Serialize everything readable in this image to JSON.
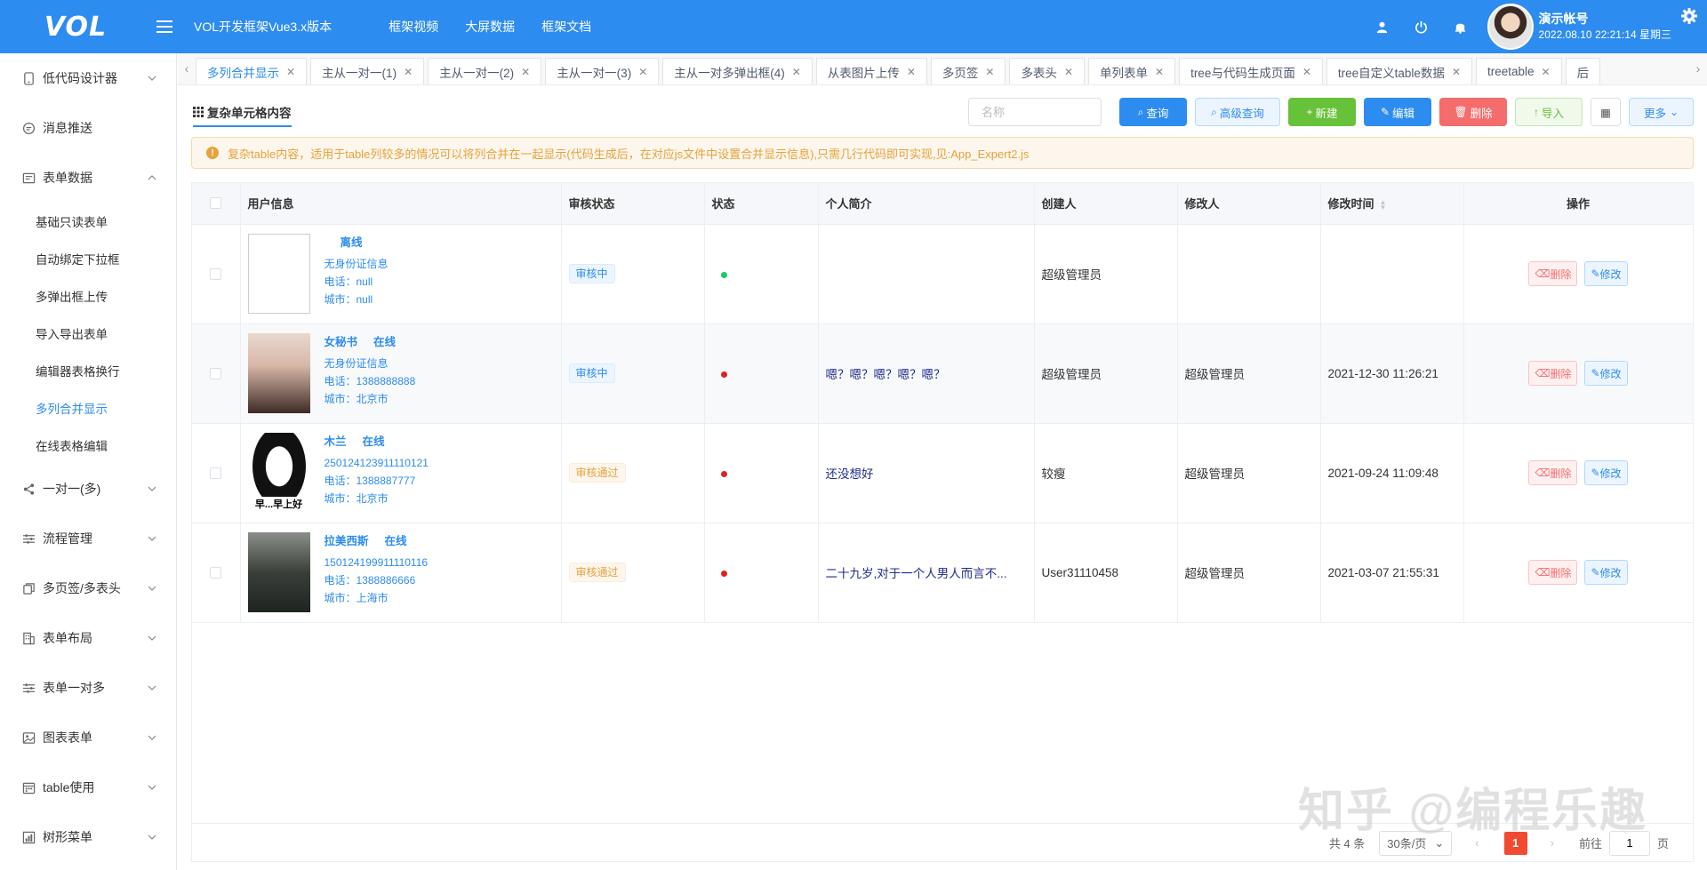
{
  "header": {
    "logo": "VOL",
    "app_title": "VOL开发框架Vue3.x版本",
    "nav": [
      "框架视频",
      "大屏数据",
      "框架文档"
    ],
    "user_name": "演示帐号",
    "user_date": "2022.08.10 22:21:14 星期三"
  },
  "sidebar": {
    "items": [
      {
        "label": "低代码设计器",
        "icon": "phone-icon"
      },
      {
        "label": "消息推送",
        "icon": "message-icon"
      },
      {
        "label": "表单数据",
        "icon": "form-icon"
      }
    ],
    "sub_items": [
      "基础只读表单",
      "自动绑定下拉框",
      "多弹出框上传",
      "导入导出表单",
      "编辑器表格换行",
      "多列合并显示",
      "在线表格编辑"
    ],
    "items_after": [
      {
        "label": "一对一(多)",
        "icon": "share-icon"
      },
      {
        "label": "流程管理",
        "icon": "sliders-icon"
      },
      {
        "label": "多页签/多表头",
        "icon": "copy-icon"
      },
      {
        "label": "表单布局",
        "icon": "building-icon"
      },
      {
        "label": "表单一对多",
        "icon": "sliders-icon"
      },
      {
        "label": "图表表单",
        "icon": "image-icon"
      },
      {
        "label": "table使用",
        "icon": "calendar-icon"
      },
      {
        "label": "树形菜单",
        "icon": "chart-icon"
      }
    ]
  },
  "tabs": [
    "多列合并显示",
    "主从一对一(1)",
    "主从一对一(2)",
    "主从一对一(3)",
    "主从一对多弹出框(4)",
    "从表图片上传",
    "多页签",
    "多表头",
    "单列表单",
    "tree与代码生成页面",
    "tree自定义table数据",
    "treetable",
    "后"
  ],
  "toolbar": {
    "title": "复杂单元格内容",
    "search_placeholder": "名称",
    "query": "查询",
    "adv_query": "高级查询",
    "new": "新建",
    "edit": "编辑",
    "delete": "删除",
    "import": "导入",
    "more": "更多"
  },
  "alert": "复杂table内容，适用于table列较多的情况可以将列合并在一起显示(代码生成后，在对应js文件中设置合并显示信息),只需几行代码即可实现,见:App_Expert2.js",
  "table": {
    "headers": [
      "用户信息",
      "审核状态",
      "状态",
      "个人简介",
      "创建人",
      "修改人",
      "修改时间",
      "操作"
    ],
    "rows": [
      {
        "name": "",
        "online": "离线",
        "id": "无身份证信息",
        "phone": "电话：null",
        "city": "城市：null",
        "audit": "审核中",
        "status_color": "#13ce66",
        "intro": "",
        "creator": "超级管理员",
        "modifier": "",
        "time": ""
      },
      {
        "name": "女秘书",
        "online": "在线",
        "id": "无身份证信息",
        "phone": "电话：1388888888",
        "city": "城市：北京市",
        "audit": "审核中",
        "status_color": "#e02020",
        "intro": "嗯？嗯？嗯？嗯？嗯？",
        "creator": "超级管理员",
        "modifier": "超级管理员",
        "time": "2021-12-30 11:26:21"
      },
      {
        "name": "木兰",
        "online": "在线",
        "id": "250124123911110121",
        "phone": "电话：1388887777",
        "city": "城市：北京市",
        "audit": "审核通过",
        "status_color": "#e02020",
        "intro": "还没想好",
        "creator": "较瘦",
        "modifier": "超级管理员",
        "time": "2021-09-24 11:09:48"
      },
      {
        "name": "拉美西斯",
        "online": "在线",
        "id": "150124199911110116",
        "phone": "电话：1388886666",
        "city": "城市：上海市",
        "audit": "审核通过",
        "status_color": "#e02020",
        "intro": "二十九岁,对于一个人男人而言不...",
        "creator": "User31110458",
        "modifier": "超级管理员",
        "time": "2021-03-07 21:55:31"
      }
    ],
    "op_delete": "删除",
    "op_edit": "修改",
    "img_text": "早...早上好"
  },
  "pager": {
    "total": "共 4 条",
    "page_size": "30条/页",
    "current": "1",
    "goto": "前往",
    "goto_value": "1",
    "page_unit": "页"
  },
  "watermark": "知乎 @编程乐趣"
}
